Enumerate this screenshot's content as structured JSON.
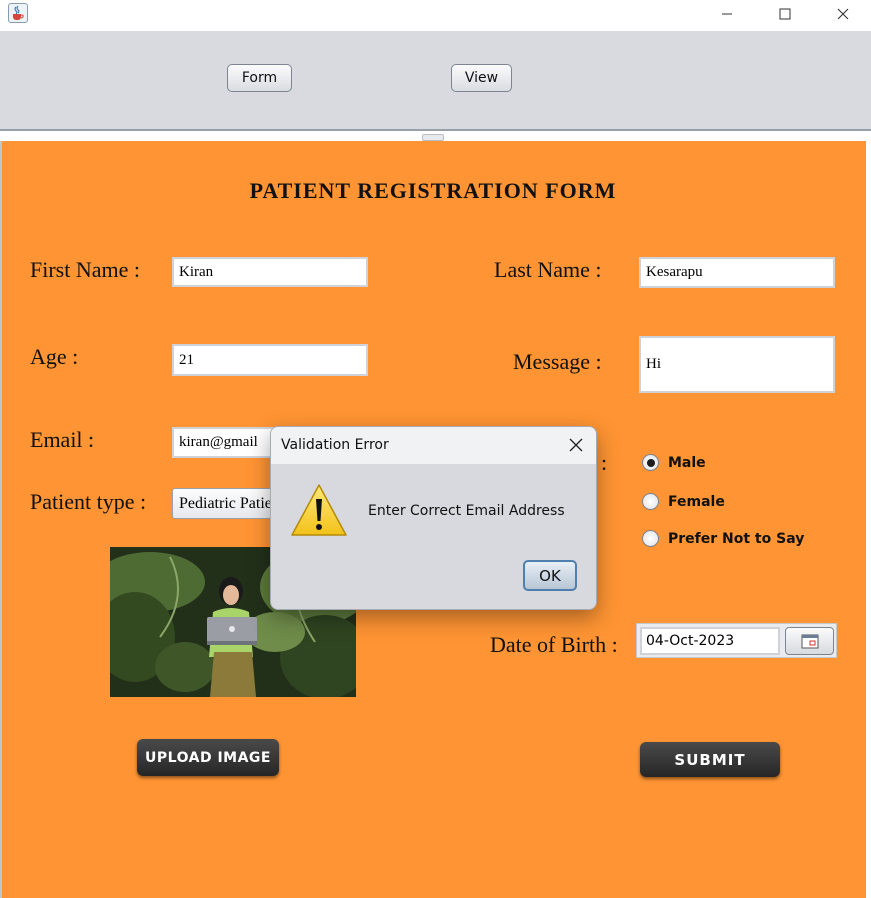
{
  "window": {
    "title_icon": "java-cup-icon",
    "controls": {
      "minimize": "minimize-icon",
      "maximize": "maximize-icon",
      "close": "close-icon"
    }
  },
  "toolbar": {
    "form_label": "Form",
    "view_label": "View"
  },
  "form": {
    "title": "PATIENT REGISTRATION FORM",
    "first_name": {
      "label": "First Name :",
      "value": "Kiran"
    },
    "last_name": {
      "label": "Last Name :",
      "value": "Kesarapu"
    },
    "age": {
      "label": "Age :",
      "value": "21"
    },
    "message": {
      "label": "Message :",
      "value": "Hi"
    },
    "email": {
      "label": "Email :",
      "value": "kiran@gmail"
    },
    "patient_type": {
      "label": "Patient type :",
      "value": "Pediatric Patient"
    },
    "gender": {
      "label": ":",
      "options": [
        "Male",
        "Female",
        "Prefer Not to Say"
      ],
      "selected": "Male"
    },
    "dob": {
      "label": "Date of Birth :",
      "value": "04-Oct-2023"
    },
    "upload_label": "UPLOAD IMAGE",
    "submit_label": "SUBMIT"
  },
  "dialog": {
    "title": "Validation Error",
    "message": "Enter Correct Email Address",
    "ok_label": "OK",
    "icon": "warning-icon"
  },
  "colors": {
    "panel_bg": "#fe9433",
    "toolbar_bg": "#d8dae0",
    "button_dark": "#2e2e2e",
    "dialog_bg": "#d7d9de"
  }
}
